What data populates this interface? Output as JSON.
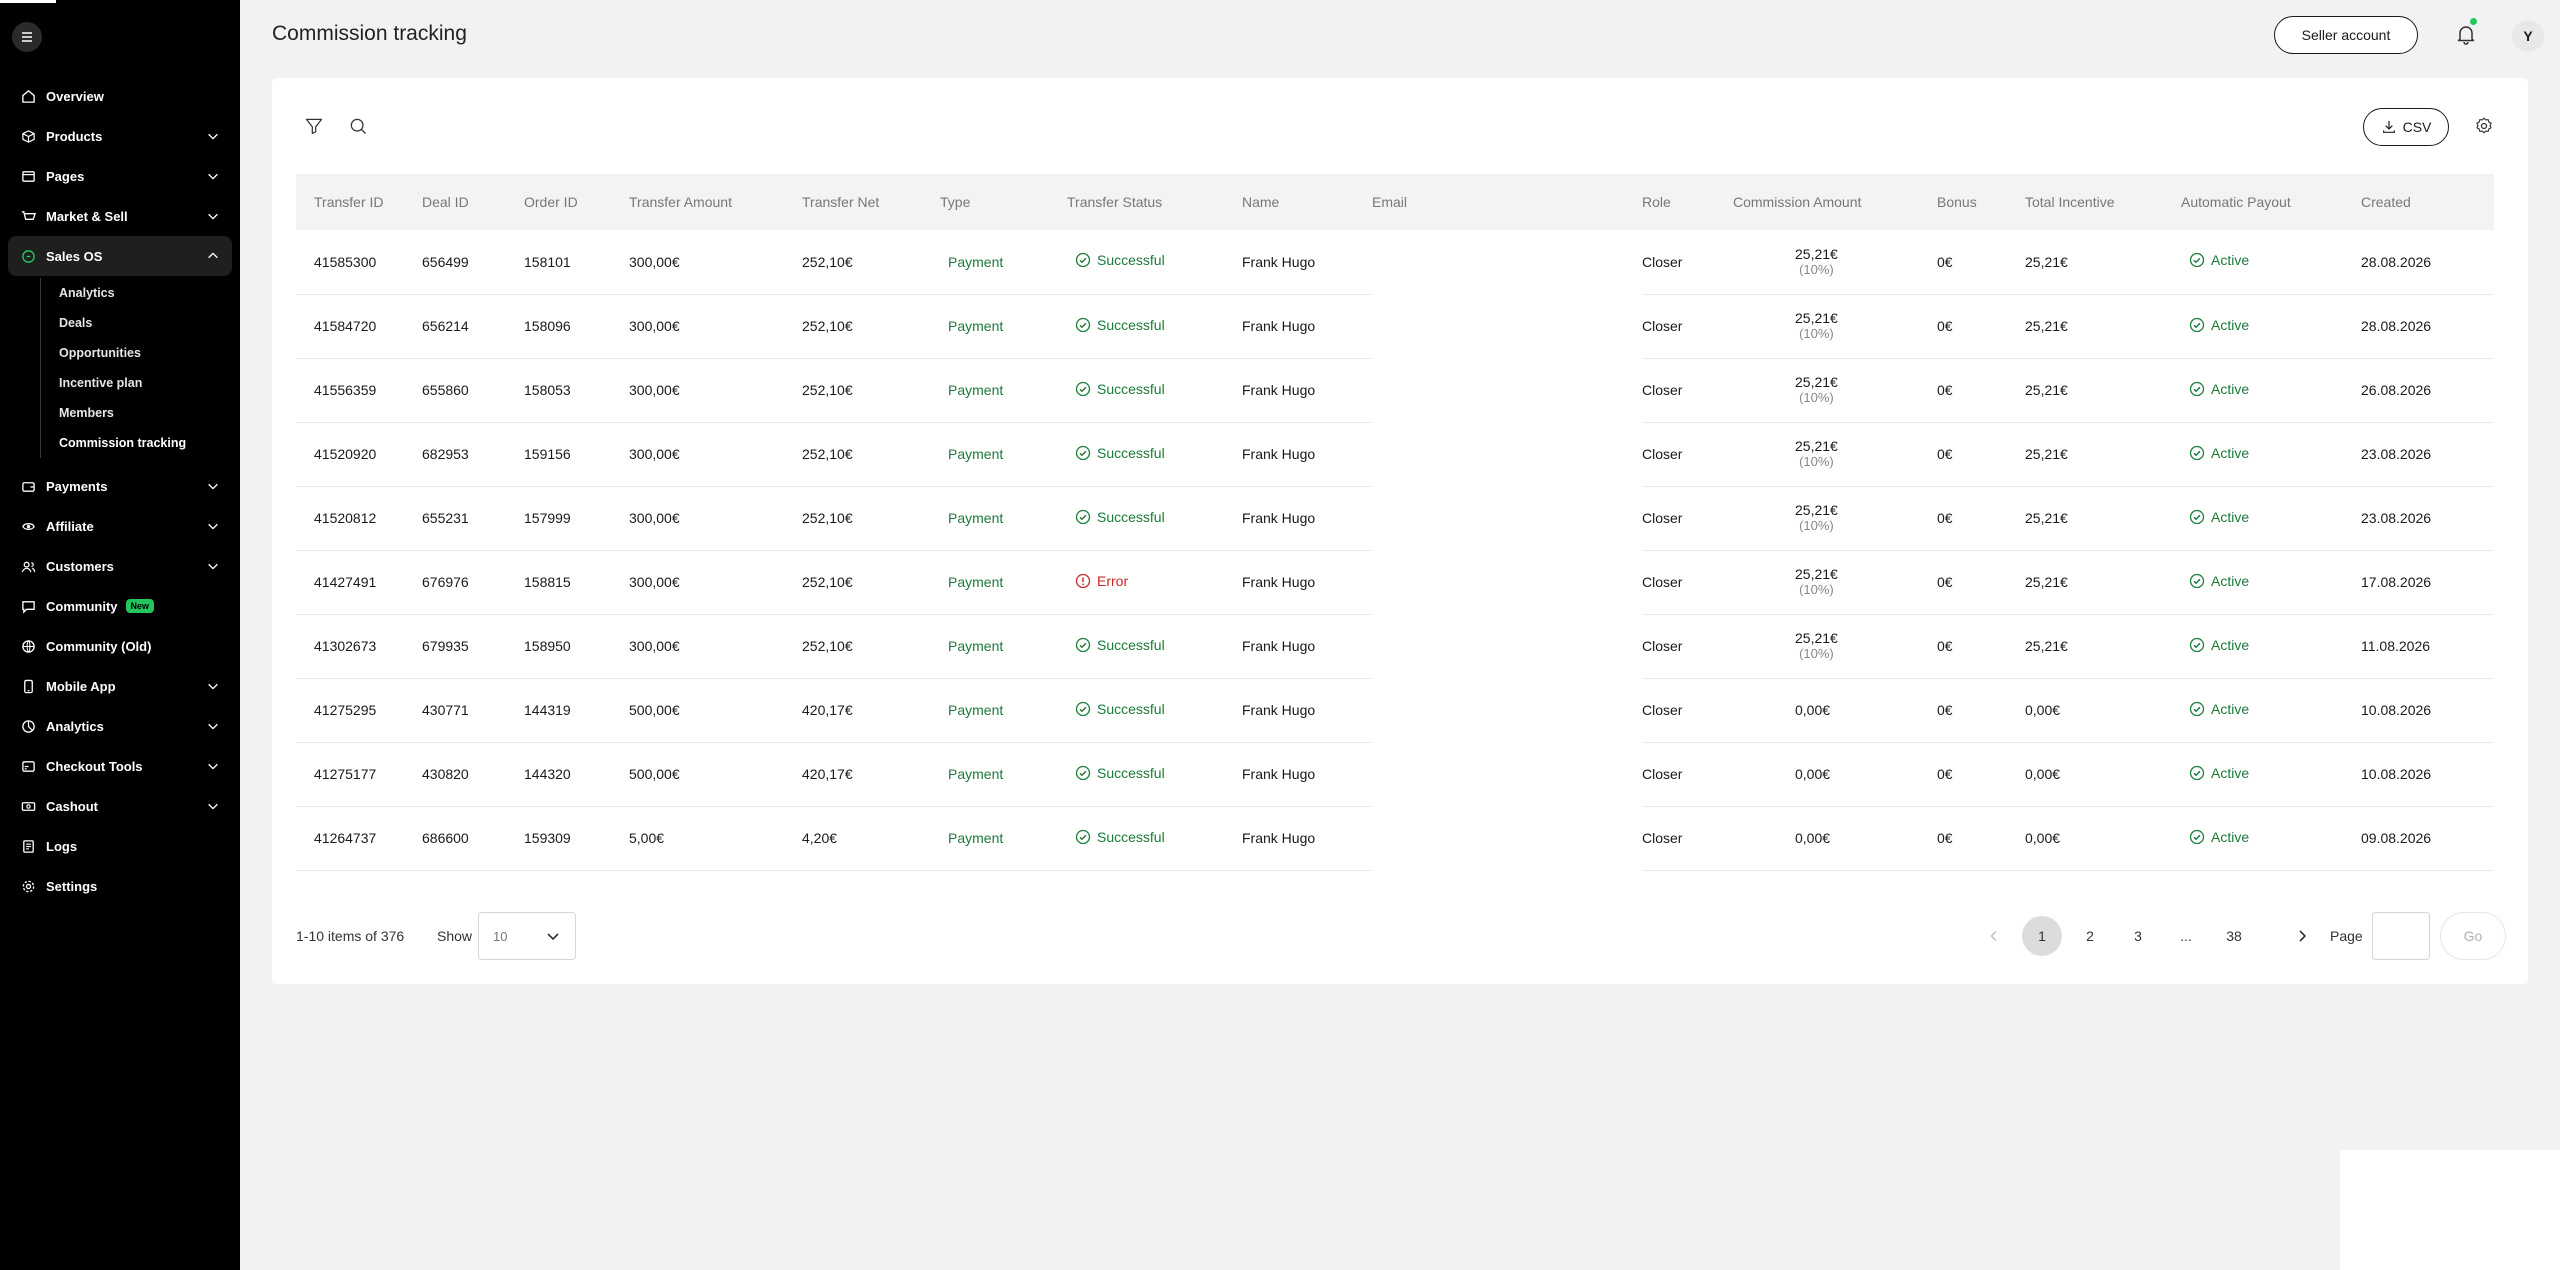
{
  "header": {
    "title": "Commission tracking",
    "seller_account": "Seller account",
    "avatar_initial": "Y"
  },
  "sidebar": {
    "items": [
      {
        "label": "Overview",
        "icon": "home-icon",
        "chevron": false
      },
      {
        "label": "Products",
        "icon": "box-icon",
        "chevron": true
      },
      {
        "label": "Pages",
        "icon": "page-icon",
        "chevron": true
      },
      {
        "label": "Market & Sell",
        "icon": "market-icon",
        "chevron": true
      },
      {
        "label": "Sales OS",
        "icon": "sales-os-icon",
        "chevron": true,
        "expanded": true
      }
    ],
    "sub_items": [
      "Analytics",
      "Deals",
      "Opportunities",
      "Incentive plan",
      "Members",
      "Commission tracking"
    ],
    "items_after": [
      {
        "label": "Payments",
        "icon": "wallet-icon",
        "chevron": true
      },
      {
        "label": "Affiliate",
        "icon": "affiliate-icon",
        "chevron": true
      },
      {
        "label": "Customers",
        "icon": "customers-icon",
        "chevron": true
      },
      {
        "label": "Community",
        "icon": "community-icon",
        "chevron": false,
        "badge": "New"
      },
      {
        "label": "Community (Old)",
        "icon": "community-old-icon",
        "chevron": false
      },
      {
        "label": "Mobile App",
        "icon": "mobile-icon",
        "chevron": true
      },
      {
        "label": "Analytics",
        "icon": "analytics-icon",
        "chevron": true
      },
      {
        "label": "Checkout Tools",
        "icon": "checkout-icon",
        "chevron": true
      },
      {
        "label": "Cashout",
        "icon": "cashout-icon",
        "chevron": true
      },
      {
        "label": "Logs",
        "icon": "logs-icon",
        "chevron": false
      },
      {
        "label": "Settings",
        "icon": "settings-icon",
        "chevron": false
      }
    ]
  },
  "toolbar": {
    "csv_label": "CSV"
  },
  "table": {
    "columns": [
      "Transfer ID",
      "Deal ID",
      "Order ID",
      "Transfer Amount",
      "Transfer Net",
      "Type",
      "Transfer Status",
      "Name",
      "Email",
      "Role",
      "Commission Amount",
      "Bonus",
      "Total Incentive",
      "Automatic Payout",
      "Created"
    ],
    "rows": [
      {
        "transfer_id": "41585300",
        "deal_id": "656499",
        "order_id": "158101",
        "amount": "300,00€",
        "net": "252,10€",
        "type": "Payment",
        "status": "Successful",
        "status_kind": "ok",
        "name": "Frank Hugo",
        "email": "",
        "role": "Closer",
        "commission": "25,21€",
        "commission_pct": "(10%)",
        "bonus": "0€",
        "total": "25,21€",
        "payout": "Active",
        "created": "28.08.2026"
      },
      {
        "transfer_id": "41584720",
        "deal_id": "656214",
        "order_id": "158096",
        "amount": "300,00€",
        "net": "252,10€",
        "type": "Payment",
        "status": "Successful",
        "status_kind": "ok",
        "name": "Frank Hugo",
        "email": "",
        "role": "Closer",
        "commission": "25,21€",
        "commission_pct": "(10%)",
        "bonus": "0€",
        "total": "25,21€",
        "payout": "Active",
        "created": "28.08.2026"
      },
      {
        "transfer_id": "41556359",
        "deal_id": "655860",
        "order_id": "158053",
        "amount": "300,00€",
        "net": "252,10€",
        "type": "Payment",
        "status": "Successful",
        "status_kind": "ok",
        "name": "Frank Hugo",
        "email": "",
        "role": "Closer",
        "commission": "25,21€",
        "commission_pct": "(10%)",
        "bonus": "0€",
        "total": "25,21€",
        "payout": "Active",
        "created": "26.08.2026"
      },
      {
        "transfer_id": "41520920",
        "deal_id": "682953",
        "order_id": "159156",
        "amount": "300,00€",
        "net": "252,10€",
        "type": "Payment",
        "status": "Successful",
        "status_kind": "ok",
        "name": "Frank Hugo",
        "email": "",
        "role": "Closer",
        "commission": "25,21€",
        "commission_pct": "(10%)",
        "bonus": "0€",
        "total": "25,21€",
        "payout": "Active",
        "created": "23.08.2026"
      },
      {
        "transfer_id": "41520812",
        "deal_id": "655231",
        "order_id": "157999",
        "amount": "300,00€",
        "net": "252,10€",
        "type": "Payment",
        "status": "Successful",
        "status_kind": "ok",
        "name": "Frank Hugo",
        "email": "",
        "role": "Closer",
        "commission": "25,21€",
        "commission_pct": "(10%)",
        "bonus": "0€",
        "total": "25,21€",
        "payout": "Active",
        "created": "23.08.2026"
      },
      {
        "transfer_id": "41427491",
        "deal_id": "676976",
        "order_id": "158815",
        "amount": "300,00€",
        "net": "252,10€",
        "type": "Payment",
        "status": "Error",
        "status_kind": "err",
        "name": "Frank Hugo",
        "email": "",
        "role": "Closer",
        "commission": "25,21€",
        "commission_pct": "(10%)",
        "bonus": "0€",
        "total": "25,21€",
        "payout": "Active",
        "created": "17.08.2026"
      },
      {
        "transfer_id": "41302673",
        "deal_id": "679935",
        "order_id": "158950",
        "amount": "300,00€",
        "net": "252,10€",
        "type": "Payment",
        "status": "Successful",
        "status_kind": "ok",
        "name": "Frank Hugo",
        "email": "",
        "role": "Closer",
        "commission": "25,21€",
        "commission_pct": "(10%)",
        "bonus": "0€",
        "total": "25,21€",
        "payout": "Active",
        "created": "11.08.2026"
      },
      {
        "transfer_id": "41275295",
        "deal_id": "430771",
        "order_id": "144319",
        "amount": "500,00€",
        "net": "420,17€",
        "type": "Payment",
        "status": "Successful",
        "status_kind": "ok",
        "name": "Frank Hugo",
        "email": "",
        "role": "Closer",
        "commission": "0,00€",
        "commission_pct": "",
        "bonus": "0€",
        "total": "0,00€",
        "payout": "Active",
        "created": "10.08.2026"
      },
      {
        "transfer_id": "41275177",
        "deal_id": "430820",
        "order_id": "144320",
        "amount": "500,00€",
        "net": "420,17€",
        "type": "Payment",
        "status": "Successful",
        "status_kind": "ok",
        "name": "Frank Hugo",
        "email": "",
        "role": "Closer",
        "commission": "0,00€",
        "commission_pct": "",
        "bonus": "0€",
        "total": "0,00€",
        "payout": "Active",
        "created": "10.08.2026"
      },
      {
        "transfer_id": "41264737",
        "deal_id": "686600",
        "order_id": "159309",
        "amount": "5,00€",
        "net": "4,20€",
        "type": "Payment",
        "status": "Successful",
        "status_kind": "ok",
        "name": "Frank Hugo",
        "email": "",
        "role": "Closer",
        "commission": "0,00€",
        "commission_pct": "",
        "bonus": "0€",
        "total": "0,00€",
        "payout": "Active",
        "created": "09.08.2026"
      }
    ]
  },
  "footer": {
    "count_text": "1-10 items of 376",
    "show_label": "Show",
    "show_value": "10",
    "pages": [
      "1",
      "2",
      "3",
      "...",
      "38"
    ],
    "current_page": "1",
    "page_label": "Page",
    "go_label": "Go"
  },
  "colors": {
    "sidebar_bg": "#000000",
    "success": "#1b7a3a",
    "error": "#c62828",
    "accent_green": "#22c55e"
  }
}
